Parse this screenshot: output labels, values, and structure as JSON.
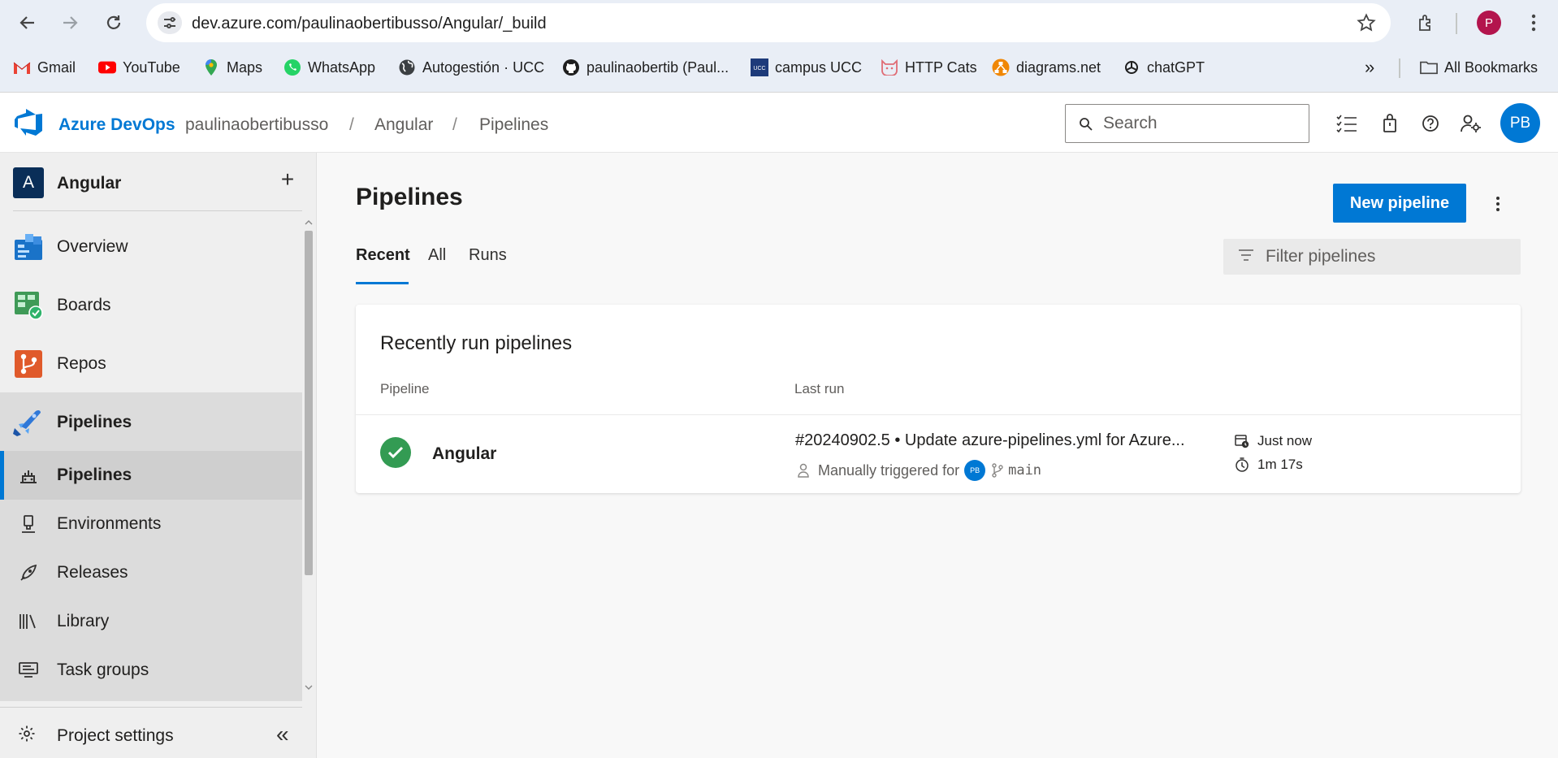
{
  "browser": {
    "url": "dev.azure.com/paulinaobertibusso/Angular/_build",
    "profile_initial": "P",
    "bookmarks": [
      {
        "label": "Gmail",
        "icon": "gmail-icon"
      },
      {
        "label": "YouTube",
        "icon": "youtube-icon"
      },
      {
        "label": "Maps",
        "icon": "maps-icon"
      },
      {
        "label": "WhatsApp",
        "icon": "whatsapp-icon"
      },
      {
        "label": "Autogestión · UCC",
        "icon": "globe-icon"
      },
      {
        "label": "paulinaobertib (Paul...",
        "icon": "github-icon"
      },
      {
        "label": "campus UCC",
        "icon": "ucc-icon"
      },
      {
        "label": "HTTP Cats",
        "icon": "cat-icon"
      },
      {
        "label": "diagrams.net",
        "icon": "diagrams-icon"
      },
      {
        "label": "chatGPT",
        "icon": "openai-icon"
      }
    ],
    "all_bookmarks": "All Bookmarks",
    "more_bookmarks": "»"
  },
  "header": {
    "brand": "Azure DevOps",
    "breadcrumbs": [
      "paulinaobertibusso",
      "Angular",
      "Pipelines"
    ],
    "separator": "/",
    "search_placeholder": "Search",
    "user_initials": "PB"
  },
  "sidebar": {
    "project_initial": "A",
    "project_name": "Angular",
    "add": "+",
    "items": [
      {
        "label": "Overview",
        "icon": "overview-icon"
      },
      {
        "label": "Boards",
        "icon": "boards-icon"
      },
      {
        "label": "Repos",
        "icon": "repos-icon"
      },
      {
        "label": "Pipelines",
        "icon": "pipelines-icon"
      }
    ],
    "sub_items": [
      {
        "label": "Pipelines",
        "icon": "pipelines-sub-icon",
        "selected": true
      },
      {
        "label": "Environments",
        "icon": "environments-icon"
      },
      {
        "label": "Releases",
        "icon": "releases-icon"
      },
      {
        "label": "Library",
        "icon": "library-icon"
      },
      {
        "label": "Task groups",
        "icon": "task-groups-icon"
      }
    ],
    "project_settings": "Project settings",
    "collapse": "«"
  },
  "main": {
    "title": "Pipelines",
    "new_pipeline": "New pipeline",
    "tabs": [
      {
        "label": "Recent",
        "selected": true
      },
      {
        "label": "All"
      },
      {
        "label": "Runs"
      }
    ],
    "filter_placeholder": "Filter pipelines",
    "card": {
      "title": "Recently run pipelines",
      "columns": [
        "Pipeline",
        "Last run"
      ],
      "rows": [
        {
          "status": "succeeded",
          "name": "Angular",
          "run_title": "#20240902.5 • Update azure-pipelines.yml for Azure...",
          "trigger": "Manually triggered for",
          "trigger_avatar": "PB",
          "branch": "main",
          "when": "Just now",
          "duration": "1m 17s"
        }
      ]
    }
  },
  "colors": {
    "accent": "#0078d4",
    "success": "#339b53",
    "project_badge": "#0a2e58"
  }
}
